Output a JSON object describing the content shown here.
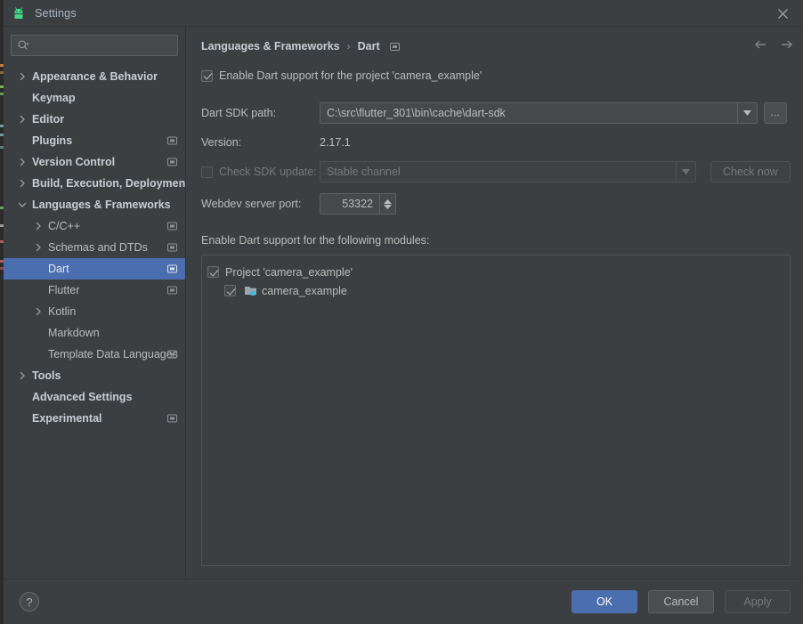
{
  "window": {
    "title": "Settings",
    "app_icon": "android-logo-icon",
    "close_label": "×"
  },
  "sidebar": {
    "search": {
      "placeholder": "",
      "value": "",
      "icon": "search-icon"
    },
    "items": [
      {
        "label": "Appearance & Behavior",
        "arrow": "collapsed",
        "indent": 0,
        "bold": true,
        "badge": false,
        "selected": false
      },
      {
        "label": "Keymap",
        "arrow": "none",
        "indent": 0,
        "bold": true,
        "badge": false,
        "selected": false
      },
      {
        "label": "Editor",
        "arrow": "collapsed",
        "indent": 0,
        "bold": true,
        "badge": false,
        "selected": false
      },
      {
        "label": "Plugins",
        "arrow": "none",
        "indent": 0,
        "bold": true,
        "badge": true,
        "selected": false
      },
      {
        "label": "Version Control",
        "arrow": "collapsed",
        "indent": 0,
        "bold": true,
        "badge": true,
        "selected": false
      },
      {
        "label": "Build, Execution, Deployment",
        "arrow": "collapsed",
        "indent": 0,
        "bold": true,
        "badge": false,
        "selected": false
      },
      {
        "label": "Languages & Frameworks",
        "arrow": "expanded",
        "indent": 0,
        "bold": true,
        "badge": false,
        "selected": false
      },
      {
        "label": "C/C++",
        "arrow": "collapsed",
        "indent": 1,
        "bold": false,
        "badge": true,
        "selected": false
      },
      {
        "label": "Schemas and DTDs",
        "arrow": "collapsed",
        "indent": 1,
        "bold": false,
        "badge": true,
        "selected": false
      },
      {
        "label": "Dart",
        "arrow": "none",
        "indent": 1,
        "bold": false,
        "badge": true,
        "selected": true
      },
      {
        "label": "Flutter",
        "arrow": "none",
        "indent": 1,
        "bold": false,
        "badge": true,
        "selected": false
      },
      {
        "label": "Kotlin",
        "arrow": "collapsed",
        "indent": 1,
        "bold": false,
        "badge": false,
        "selected": false
      },
      {
        "label": "Markdown",
        "arrow": "none",
        "indent": 1,
        "bold": false,
        "badge": false,
        "selected": false
      },
      {
        "label": "Template Data Languages",
        "arrow": "none",
        "indent": 1,
        "bold": false,
        "badge": true,
        "selected": false
      },
      {
        "label": "Tools",
        "arrow": "collapsed",
        "indent": 0,
        "bold": true,
        "badge": false,
        "selected": false
      },
      {
        "label": "Advanced Settings",
        "arrow": "none",
        "indent": 0,
        "bold": true,
        "badge": false,
        "selected": false
      },
      {
        "label": "Experimental",
        "arrow": "none",
        "indent": 0,
        "bold": true,
        "badge": true,
        "selected": false
      }
    ]
  },
  "content": {
    "breadcrumb": {
      "parent": "Languages & Frameworks",
      "separator": "›",
      "current": "Dart",
      "badge_icon": "module-scope-icon"
    },
    "nav": {
      "back_icon": "arrow-left-icon",
      "forward_icon": "arrow-right-icon"
    },
    "enable_support": {
      "label": "Enable Dart support for the project 'camera_example'",
      "checked": true
    },
    "sdk_path": {
      "label": "Dart SDK path:",
      "value": "C:\\src\\flutter_301\\bin\\cache\\dart-sdk",
      "browse_label": "…"
    },
    "version": {
      "label": "Version:",
      "value": "2.17.1"
    },
    "check_update": {
      "label": "Check SDK update:",
      "checked": false,
      "disabled": true,
      "channel_value": "Stable channel",
      "button_label": "Check now"
    },
    "webdev_port": {
      "label": "Webdev server port:",
      "value": "53322"
    },
    "modules": {
      "label": "Enable Dart support for the following modules:",
      "rows": [
        {
          "label": "Project 'camera_example'",
          "checked": true,
          "indent": false,
          "icon": null
        },
        {
          "label": "camera_example",
          "checked": true,
          "indent": true,
          "icon": "module-folder-icon"
        }
      ]
    }
  },
  "footer": {
    "help_label": "?",
    "ok_label": "OK",
    "cancel_label": "Cancel",
    "apply_label": "Apply"
  },
  "colors": {
    "background": "#3c3f41",
    "accent": "#4b6eaf",
    "text": "#bbbbbb",
    "android_green": "#3ddc84"
  }
}
